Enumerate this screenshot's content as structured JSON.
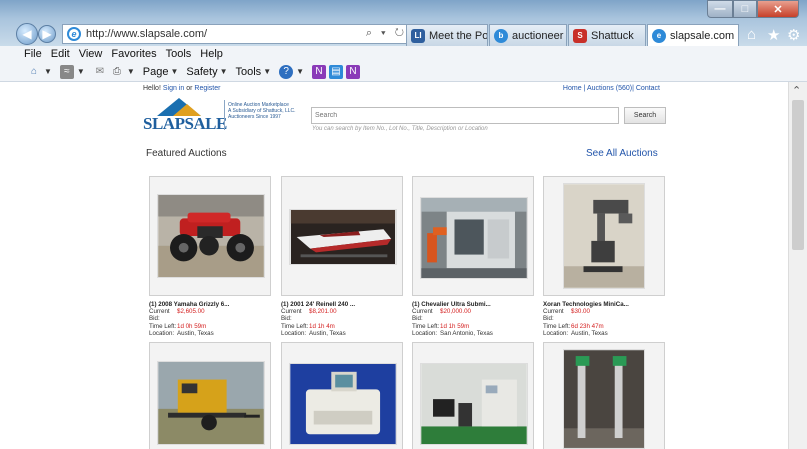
{
  "browser": {
    "address": "http://www.slapsale.com/",
    "address_tools": "⌕ ▾ ↻",
    "tabs": [
      {
        "label": "Meet the Powe...",
        "icon": "LI",
        "color": "#2f5f9e"
      },
      {
        "label": "auctioneer - Bi...",
        "icon": "b",
        "color": "#2e8ad8"
      },
      {
        "label": "Shattuck",
        "icon": "S",
        "color": "#c8302a"
      },
      {
        "label": "slapsale.com",
        "icon": "e",
        "color": "#2e8ad8",
        "active": true
      }
    ],
    "menu": [
      "File",
      "Edit",
      "View",
      "Favorites",
      "Tools",
      "Help"
    ],
    "commands": {
      "page": "Page",
      "safety": "Safety",
      "tools": "Tools"
    }
  },
  "page": {
    "hello": "Hello!",
    "sign_in": "Sign in",
    "or": "or",
    "register": "Register",
    "nav": {
      "home": "Home",
      "auctions": "Auctions (560)",
      "contact": "Contact",
      "sep": "|"
    },
    "logo_text": "SLAPSALE",
    "tagline": [
      "Online Auction Marketplace",
      "A Subsidiary of Shattuck, LLC.",
      "Auctioneers Since 1997"
    ],
    "search_placeholder": "Search",
    "search_button": "Search",
    "search_hint": "You can search by Item No., Lot No., Title, Description or Location",
    "featured_title": "Featured Auctions",
    "see_all": "See All Auctions",
    "labels": {
      "bid": "Current Bid:",
      "time": "Time Left:",
      "loc": "Location:"
    },
    "cards": [
      {
        "title": "(1) 2008 Yamaha Grizzly 6...",
        "bid": "$2,605.00",
        "time": "1d 0h 59m",
        "loc": "Austin, Texas"
      },
      {
        "title": "(1) 2001 24' Reinell 240 ...",
        "bid": "$8,201.00",
        "time": "1d 1h 4m",
        "loc": "Austin, Texas"
      },
      {
        "title": "(1) Chevalier Ultra Submi...",
        "bid": "$20,000.00",
        "time": "1d 1h 59m",
        "loc": "San Antonio, Texas"
      },
      {
        "title": "Xoran Technologies MiniCa...",
        "bid": "$30.00",
        "time": "6d 23h 47m",
        "loc": "Austin, Texas"
      }
    ]
  }
}
